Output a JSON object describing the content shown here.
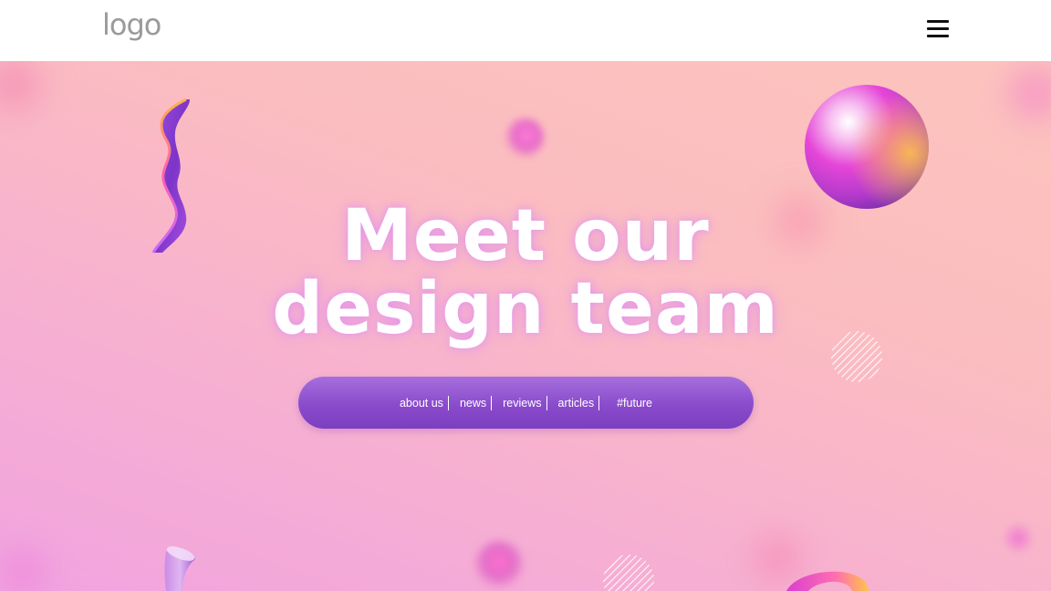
{
  "header": {
    "logo_text": "logo",
    "menu_icon": "hamburger-menu-icon"
  },
  "hero": {
    "headline_line1": "Meet our",
    "headline_line2": "design team"
  },
  "nav": {
    "items": [
      {
        "label": "about us"
      },
      {
        "label": "news"
      },
      {
        "label": "reviews"
      },
      {
        "label": "articles"
      },
      {
        "label": "#future"
      }
    ]
  },
  "colors": {
    "header_bg": "#ffffff",
    "logo": "#9a9a9a",
    "pill_top": "#a66fdc",
    "pill_bottom": "#7a3fbf",
    "hero_bg_light": "#fcc4bd",
    "hero_bg_pink": "#f1a3e0",
    "headline": "#ffffff"
  },
  "decorations": [
    "wavy-ribbon-shape",
    "gradient-sphere",
    "striped-circle",
    "blurred-orbs",
    "curved-tube-shape",
    "torus-ring-shape"
  ]
}
